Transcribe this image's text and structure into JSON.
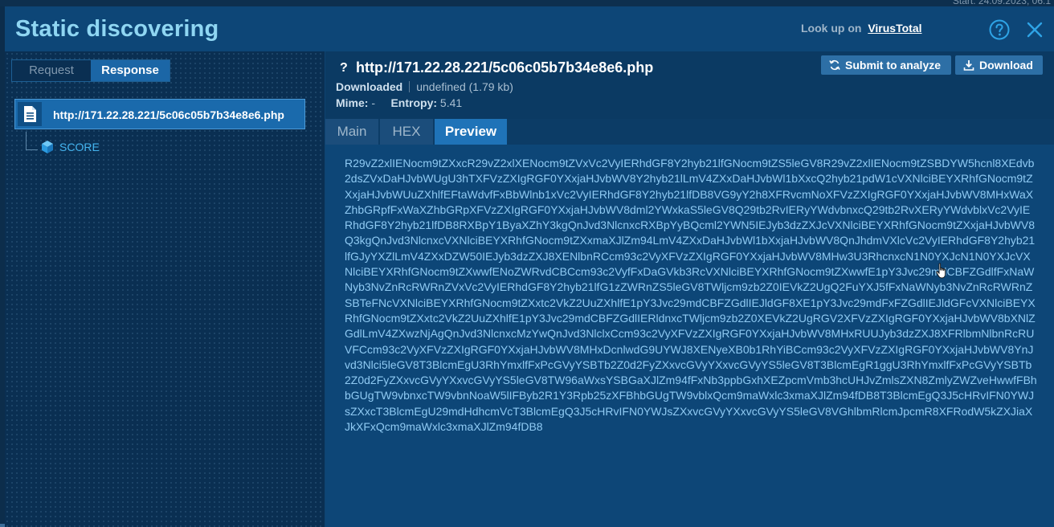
{
  "background": {
    "start_label": "Start: 24.09.2023, 06:1"
  },
  "header": {
    "title": "Static discovering",
    "lookup_prefix": "Look up on",
    "lookup_link": "VirusTotal"
  },
  "left_panel": {
    "tabs": {
      "request": "Request",
      "response": "Response",
      "active": "Response"
    },
    "tree": {
      "root": {
        "label": "http://171.22.28.221/5c06c05b7b34e8e6.php",
        "icon": "file-icon"
      },
      "children": [
        {
          "label": "SCORE",
          "icon": "cube-icon"
        }
      ]
    }
  },
  "file": {
    "prefix": "?",
    "url": "http://171.22.28.221/5c06c05b7b34e8e6.php",
    "status": "Downloaded",
    "size": "undefined (1.79 kb)",
    "mime_label": "Mime:",
    "mime_value": "-",
    "entropy_label": "Entropy:",
    "entropy_value": "5.41"
  },
  "actions": {
    "submit": "Submit to analyze",
    "download": "Download"
  },
  "tabs": {
    "main": "Main",
    "hex": "HEX",
    "preview": "Preview",
    "active": "Preview"
  },
  "preview": {
    "text": "R29vZ2xlIENocm9tZXxcR29vZ2xlXENocm9tZVxVc2VyIERhdGF8Y2hyb21lfGNocm9tZS5leGV8R29vZ2xlIENocm9tZSBDYW5hcnl8XEdvb2dsZVxDaHJvbWUgU3hTXFVzZXIgRGF0YXxjaHJvbWV8Y2hyb21lLmV4ZXxDaHJvbWl1bXxcQ2hyb21pdW1cVXNlciBEYXRhfGNocm9tZXxjaHJvbWUuZXhlfEFtaWdvfFxBbWlnb1xVc2VyIERhdGF8Y2hyb21lfDB8VG9yY2h8XFRvcmNoXFVzZXIgRGF0YXxjaHJvbWV8MHxWaXZhbGRpfFxWaXZhbGRpXFVzZXIgRGF0YXxjaHJvbWV8dml2YWxkaS5leGV8Q29tb2RvIERyYWdvbnxcQ29tb2RvXERyYWdvblxVc2VyIERhdGF8Y2hyb21lfDB8RXBpY1ByaXZhY3kgQnJvd3NlcnxcRXBpYyBQcml2YWN5IEJyb3dzZXJcVXNlciBEYXRhfGNocm9tZXxjaHJvbWV8Q3kgQnJvd3NlcnxcVXNlciBEYXRhfGNocm9tZXxmaXJlZm94LmV4ZXxDaHJvbWl1bXxjaHJvbWV8QnJhdmVXlcVc2VyIERhdGF8Y2hyb21lfGJyYXZlLmV4ZXxDZW50IEJyb3dzZXJ8XENlbnRCcm93c2VyXFVzZXIgRGF0YXxjaHJvbWV8MHw3U3RhcnxcN1N0YXJcN1N0YXJcVXNlciBEYXRhfGNocm9tZXwwfENoZWRvdCBCcm93c2VyfFxDaGVkb3RcVXNlciBEYXRhfGNocm9tZXwwfE1pY3Jvc29mdCBFZGdlfFxNaWNyb3NvZnRcRWRnZVxVc2VyIERhdGF8Y2hyb21lfG1zZWRnZS5leGV8TWljcm9zb2Z0IEVkZ2UgQ2FuYXJ5fFxNaWNyb3NvZnRcRWRnZSBTeFNcVXNlciBEYXRhfGNocm9tZXxtc2VkZ2UuZXhlfE1pY3Jvc29mdCBFZGdlIEJldGF8XE1pY3Jvc29mdFxFZGdlIEJldGFcVXNlciBEYXRhfGNocm9tZXxtc2VkZ2UuZXhlfE1pY3Jvc29mdCBFZGdlIERldnxcTWljcm9zb2Z0XEVkZ2UgRGV2XFVzZXIgRGF0YXxjaHJvbWV8bXNlZGdlLmV4ZXwzNjAgQnJvd3NlcnxcMzYwQnJvd3NlclxCcm93c2VyXFVzZXIgRGF0YXxjaHJvbWV8MHxRUUJyb3dzZXJ8XFRlbmNlbnRcRUVFCcm93c2VyXFVzZXIgRGF0YXxjaHJvbWV8MHxDcnlwdG9UYWJ8XENyeXB0b1RhYiBCcm93c2VyXFVzZXIgRGF0YXxjaHJvbWV8YnJvd3Nlci5leGV8T3BlcmEgU3RhYmxlfFxPcGVyYSBTb2Z0d2FyZXxvcGVyYXxvcGVyYS5leGV8T3BlcmEgR1ggU3RhYmxlfFxPcGVyYSBTb2Z0d2FyZXxvcGVyYXxvcGVyYS5leGV8TW96aWxsYSBGaXJlZm94fFxNb3ppbGxhXEZpcmVmb3hcUHJvZmlsZXN8ZmlyZWZveHwwfFBhbGUgTW9vbnxcTW9vbnNoaW5lIFByb2R1Y3Rpb25zXFBhbGUgTW9vblxQcm9maWxlc3xmaXJlZm94fDB8T3BlcmEgQ3J5cHRvIFN0YWJsZXxcT3BlcmEgU29mdHdhcmVcT3BlcmEgQ3J5cHRvIFN0YWJsZXxvcGVyYXxvcGVyYS5leGV8VGhlbmRlcmJpcmR8XFRodW5kZXJiaXJkXFxQcm9maWxlc3xmaXJlZm94fDB8"
  },
  "colors": {
    "accent": "#1f73b8",
    "title": "#8fd6f2",
    "preview_text": "#8fcaf3"
  }
}
